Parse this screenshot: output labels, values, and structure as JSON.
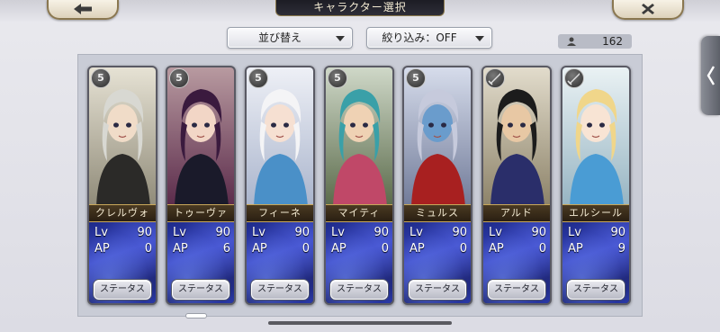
{
  "header": {
    "title": "キャラクター選択",
    "back_icon": "arrow-left-icon",
    "close_icon": "close-icon"
  },
  "controls": {
    "sort_label": "並び替え",
    "filter_label": "絞り込み：OFF",
    "character_count": "162"
  },
  "characters": [
    {
      "name": "クレルヴォ",
      "lv_label": "Lv",
      "lv": "90",
      "ap_label": "AP",
      "ap": "0",
      "status_label": "ステータス",
      "badge": "5",
      "badge_icon": "star-coin-icon"
    },
    {
      "name": "トゥーヴァ",
      "lv_label": "Lv",
      "lv": "90",
      "ap_label": "AP",
      "ap": "6",
      "status_label": "ステータス",
      "badge": "5",
      "badge_icon": "star-coin-icon"
    },
    {
      "name": "フィーネ",
      "lv_label": "Lv",
      "lv": "90",
      "ap_label": "AP",
      "ap": "0",
      "status_label": "ステータス",
      "badge": "5",
      "badge_icon": "star-coin-icon"
    },
    {
      "name": "マイティ",
      "lv_label": "Lv",
      "lv": "90",
      "ap_label": "AP",
      "ap": "0",
      "status_label": "ステータス",
      "badge": "5",
      "badge_icon": "star-coin-icon"
    },
    {
      "name": "ミュルス",
      "lv_label": "Lv",
      "lv": "90",
      "ap_label": "AP",
      "ap": "0",
      "status_label": "ステータス",
      "badge": "5",
      "badge_icon": "star-coin-icon"
    },
    {
      "name": "アルド",
      "lv_label": "Lv",
      "lv": "90",
      "ap_label": "AP",
      "ap": "0",
      "status_label": "ステータス",
      "badge": "",
      "badge_icon": "sword-icon"
    },
    {
      "name": "エルシール",
      "lv_label": "Lv",
      "lv": "90",
      "ap_label": "AP",
      "ap": "9",
      "status_label": "ステータス",
      "badge": "",
      "badge_icon": "sword-icon"
    }
  ],
  "colors": {
    "stat_panel": "#2b3aa8",
    "name_bar": "#3a2c18",
    "accent_gold": "#c9a85a"
  }
}
